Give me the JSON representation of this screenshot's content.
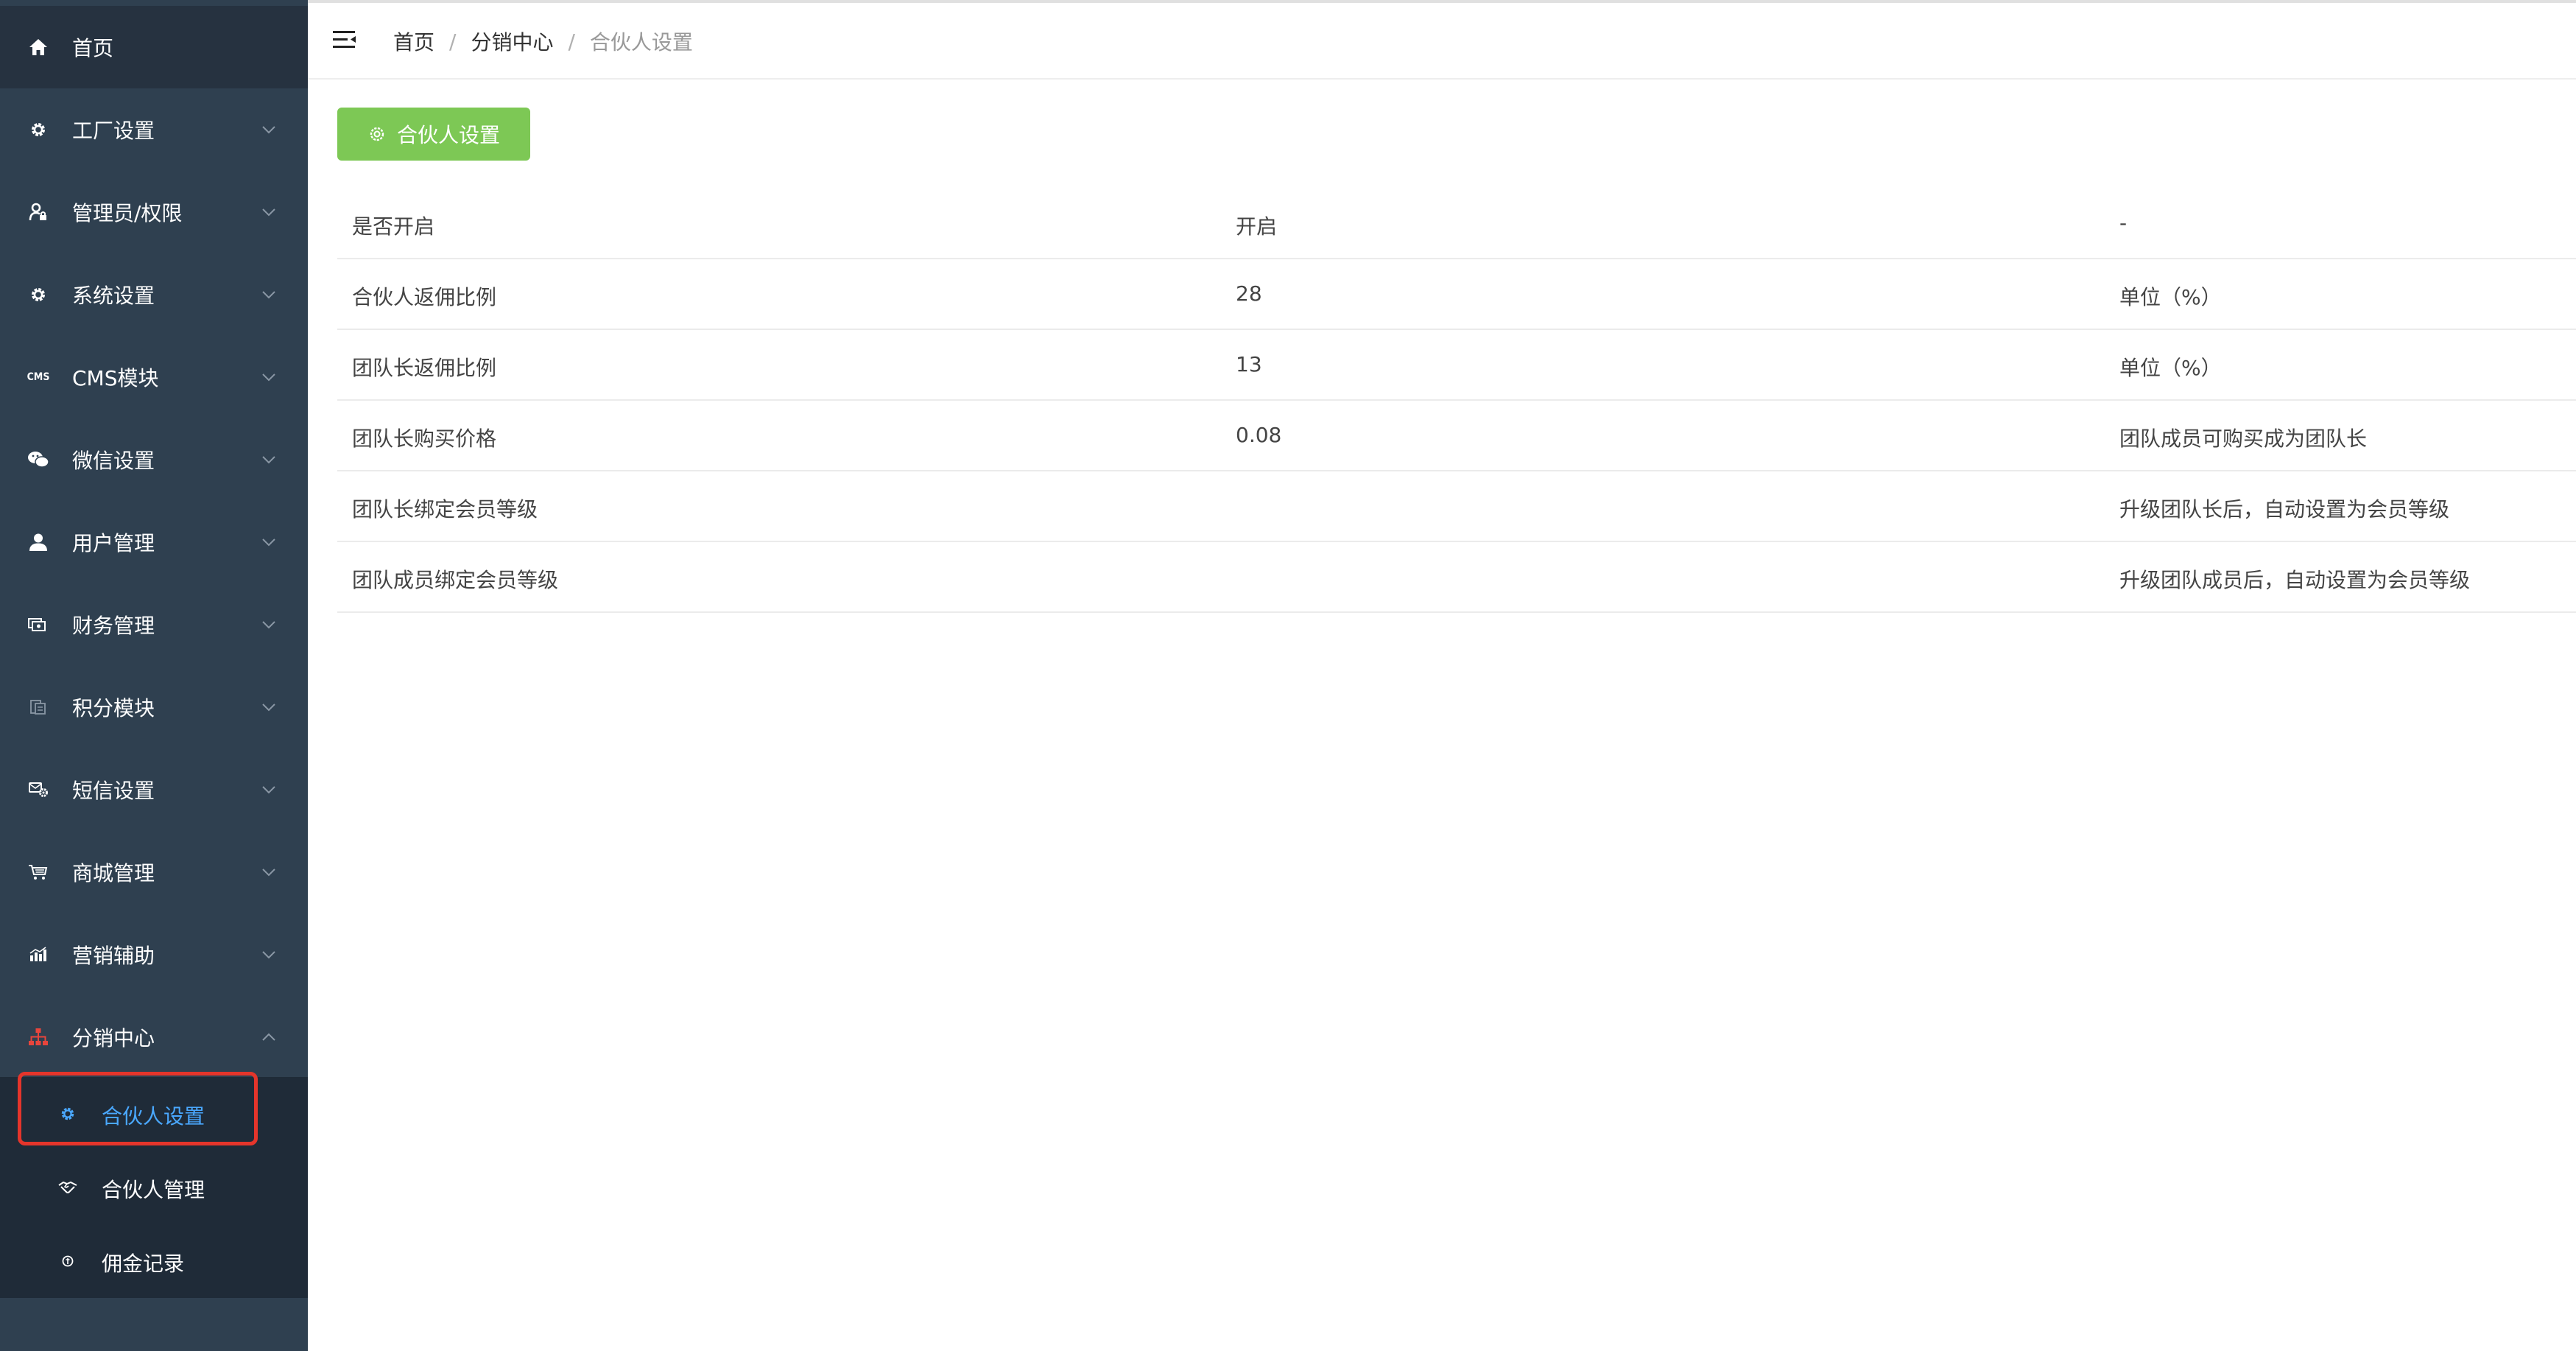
{
  "sidebar": {
    "home": {
      "label": "首页",
      "icon": "home-icon"
    },
    "items": [
      {
        "label": "工厂设置",
        "icon": "gear-icon",
        "expanded": false
      },
      {
        "label": "管理员/权限",
        "icon": "user-lock-icon",
        "expanded": false
      },
      {
        "label": "系统设置",
        "icon": "gear-icon",
        "expanded": false
      },
      {
        "label": "CMS模块",
        "icon": "cms-icon",
        "icon_text": "CMS",
        "expanded": false
      },
      {
        "label": "微信设置",
        "icon": "wechat-icon",
        "expanded": false
      },
      {
        "label": "用户管理",
        "icon": "user-icon",
        "expanded": false
      },
      {
        "label": "财务管理",
        "icon": "money-icon",
        "expanded": false
      },
      {
        "label": "积分模块",
        "icon": "points-icon",
        "expanded": false
      },
      {
        "label": "短信设置",
        "icon": "sms-settings-icon",
        "expanded": false
      },
      {
        "label": "商城管理",
        "icon": "cart-icon",
        "expanded": false
      },
      {
        "label": "营销辅助",
        "icon": "chart-icon",
        "expanded": false
      },
      {
        "label": "分销中心",
        "icon": "sitemap-icon",
        "expanded": true
      }
    ],
    "submenu": [
      {
        "label": "合伙人设置",
        "icon": "gear-icon",
        "active": true
      },
      {
        "label": "合伙人管理",
        "icon": "handshake-icon",
        "active": false
      },
      {
        "label": "佣金记录",
        "icon": "coin-icon",
        "active": false
      }
    ]
  },
  "header": {
    "breadcrumb": [
      "首页",
      "分销中心",
      "合伙人设置"
    ],
    "separator": "/"
  },
  "toolbar": {
    "settings_button_label": "合伙人设置"
  },
  "table": {
    "rows": [
      [
        "是否开启",
        "开启",
        "-"
      ],
      [
        "合伙人返佣比例",
        "28",
        "单位（%）"
      ],
      [
        "团队长返佣比例",
        "13",
        "单位（%）"
      ],
      [
        "团队长购买价格",
        "0.08",
        "团队成员可购买成为团队长"
      ],
      [
        "团队长绑定会员等级",
        "",
        "升级团队长后，自动设置为会员等级"
      ],
      [
        "团队成员绑定会员等级",
        "",
        "升级团队成员后，自动设置为会员等级"
      ]
    ]
  },
  "colors": {
    "sidebar_bg": "#2f4050",
    "submenu_bg": "#1f2b38",
    "accent_green": "#7dc855",
    "active_blue": "#4aa8ff",
    "highlight_red": "#e5352b",
    "sitemap_red": "#e8453c"
  }
}
